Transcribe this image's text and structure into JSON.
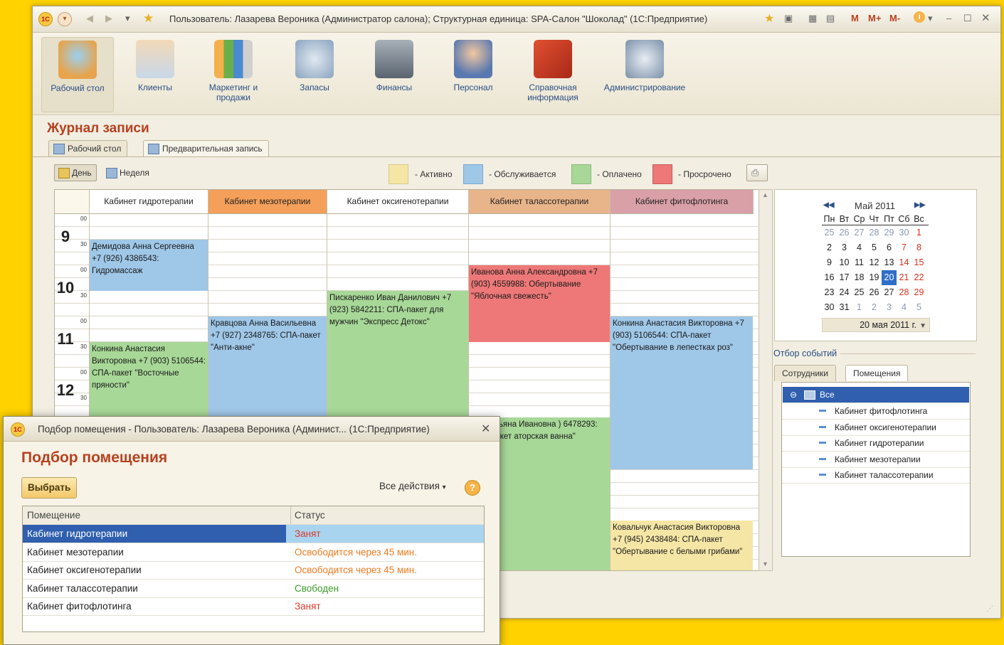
{
  "window": {
    "title": "Пользователь: Лазарева Вероника (Администратор салона);  Структурная единица: SPA-Салон \"Шоколад\" (1С:Предприятие)",
    "logo": "1С",
    "right_tools": [
      "M",
      "M+",
      "M-"
    ]
  },
  "sections": [
    {
      "label": "Рабочий стол",
      "icon": "desk-icon"
    },
    {
      "label": "Клиенты",
      "icon": "clients-icon"
    },
    {
      "label": "Маркетинг и продажи",
      "icon": "marketing-icon"
    },
    {
      "label": "Запасы",
      "icon": "stock-icon"
    },
    {
      "label": "Финансы",
      "icon": "finance-icon"
    },
    {
      "label": "Персонал",
      "icon": "staff-icon"
    },
    {
      "label": "Справочная информация",
      "icon": "reference-icon"
    },
    {
      "label": "Администрирование",
      "icon": "admin-icon"
    }
  ],
  "journal": {
    "title": "Журнал записи",
    "tabs": [
      "Рабочий стол",
      "Предварительная запись"
    ]
  },
  "toolbar": {
    "day": "День",
    "week": "Неделя"
  },
  "legend": [
    {
      "label": "- Активно",
      "color": "#f5e6a6"
    },
    {
      "label": "- Обслуживается",
      "color": "#9fc7e8"
    },
    {
      "label": "- Оплачено",
      "color": "#a8d898"
    },
    {
      "label": "- Просрочено",
      "color": "#ee7878"
    }
  ],
  "schedule": {
    "columns": [
      {
        "name": "Кабинет гидротерапии",
        "color": "#fbf7ea"
      },
      {
        "name": "Кабинет мезотерапии",
        "color": "#f4a05a"
      },
      {
        "name": "Кабинет оксигенотерапии",
        "color": "#fbf7ea"
      },
      {
        "name": "Кабинет талассотерапии",
        "color": "#e8b48a"
      },
      {
        "name": "Кабинет фитофлотинга",
        "color": "#d9a0a8"
      }
    ],
    "hours": [
      "9",
      "10",
      "11",
      "12"
    ],
    "minute_labels": [
      "00",
      "30"
    ],
    "events": [
      {
        "text": "Демидова Анна Сергеевна +7 (926) 4386543: Гидромассаж",
        "status": "blue"
      },
      {
        "text": "Конкина Анастасия Викторовна +7 (903) 5106544: СПА-пакет \"Восточные пряности\"",
        "status": "green"
      },
      {
        "text": "Кравцова Анна Васильевна +7 (927) 2348765: СПА-пакет \"Анти-акне\"",
        "status": "blue"
      },
      {
        "text": "Пискаренко Иван Данилович +7 (923) 5842211: СПА-пакет для мужчин \"Экспресс Детокс\"",
        "status": "green"
      },
      {
        "text": "Иванова Анна Александровна +7 (903) 4559988: Обертывание \"Яблочная свежесть\"",
        "status": "red"
      },
      {
        "text": "Конкина Анастасия Викторовна +7 (903) 5106544: СПА-пакет \"Обертывание в лепестках роз\"",
        "status": "blue"
      },
      {
        "text": "нко Татьяна Ивановна ) 6478293: СПА-пакет аторская ванна\"",
        "status": "green"
      },
      {
        "text": "Ковальчук Анастасия Викторовна +7 (945) 2438484: СПА-пакет \"Обертывание с белыми грибами\"",
        "status": "yellow"
      }
    ]
  },
  "calendar": {
    "month": "Май 2011",
    "weekdays": [
      "Пн",
      "Вт",
      "Ср",
      "Чт",
      "Пт",
      "Сб",
      "Вс"
    ],
    "weeks": [
      [
        "25",
        "26",
        "27",
        "28",
        "29",
        "30",
        "1"
      ],
      [
        "2",
        "3",
        "4",
        "5",
        "6",
        "7",
        "8"
      ],
      [
        "9",
        "10",
        "11",
        "12",
        "13",
        "14",
        "15"
      ],
      [
        "16",
        "17",
        "18",
        "19",
        "20",
        "21",
        "22"
      ],
      [
        "23",
        "24",
        "25",
        "26",
        "27",
        "28",
        "29"
      ],
      [
        "30",
        "31",
        "1",
        "2",
        "3",
        "4",
        "5"
      ]
    ],
    "selected": "20",
    "date_field": "20 мая 2011 г."
  },
  "filter": {
    "title": "Отбор событий",
    "tabs": [
      "Сотрудники",
      "Помещения"
    ],
    "root": "Все",
    "items": [
      "Кабинет фитофлотинга",
      "Кабинет оксигенотерапии",
      "Кабинет гидротерапии",
      "Кабинет мезотерапии",
      "Кабинет талассотерапии"
    ]
  },
  "dialog": {
    "title": "Подбор помещения - Пользователь: Лазарева Вероника (Админист...  (1С:Предприятие)",
    "heading": "Подбор помещения",
    "select_button": "Выбрать",
    "all_actions": "Все действия",
    "columns": [
      "Помещение",
      "Статус"
    ],
    "rows": [
      {
        "room": "Кабинет гидротерапии",
        "status": "Занят",
        "color": "#e03a2a"
      },
      {
        "room": "Кабинет мезотерапии",
        "status": "Освободится через 45 мин.",
        "color": "#f07a20"
      },
      {
        "room": "Кабинет оксигенотерапии",
        "status": "Освободится через 45 мин.",
        "color": "#f07a20"
      },
      {
        "room": "Кабинет талассотерапии",
        "status": "Свободен",
        "color": "#3a9a2a"
      },
      {
        "room": "Кабинет фитофлотинга",
        "status": "Занят",
        "color": "#e03a2a"
      }
    ]
  }
}
